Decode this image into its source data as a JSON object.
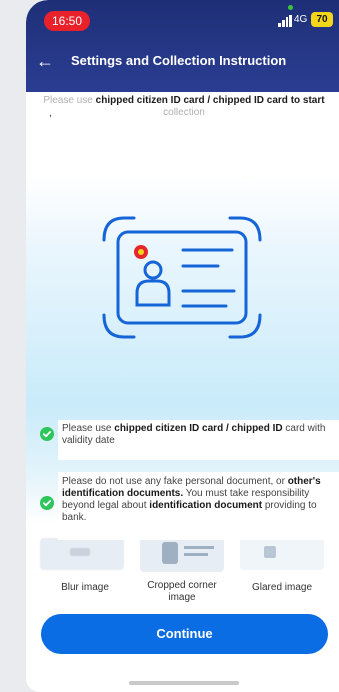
{
  "status_bar": {
    "time": "16:50",
    "network": "4G",
    "battery": "70"
  },
  "header": {
    "title": "Settings and Collection Instruction"
  },
  "instruction": {
    "pre": "Please use ",
    "bold": "chipped citizen ID card / chipped ID card to start",
    "post": " collection",
    "mark": ","
  },
  "samples": [
    {
      "label": "Blur image"
    },
    {
      "label": "Cropped corner image"
    },
    {
      "label": "Glared image"
    }
  ],
  "notes": {
    "note1": {
      "pre": "Please use ",
      "bold": "chipped citizen ID card / chipped ID",
      "post": " card with validity date"
    },
    "note2": {
      "pre": "Please do not use any fake personal document, or ",
      "bold1": "other's identification documents.",
      "mid": " You must take responsibility beyond legal about ",
      "bold2": "identification document",
      "post": " providing to bank."
    }
  },
  "actions": {
    "continue_label": "Continue"
  },
  "colors": {
    "header_bg": "#1e2f77",
    "primary": "#0a6de3",
    "success": "#2ec55b",
    "time_pill": "#e8212a",
    "battery": "#f3d61b",
    "emblem": "#e6262b"
  },
  "icons": {
    "back": "back-arrow-icon",
    "check": "check-circle-icon",
    "id_card": "id-card-icon"
  }
}
